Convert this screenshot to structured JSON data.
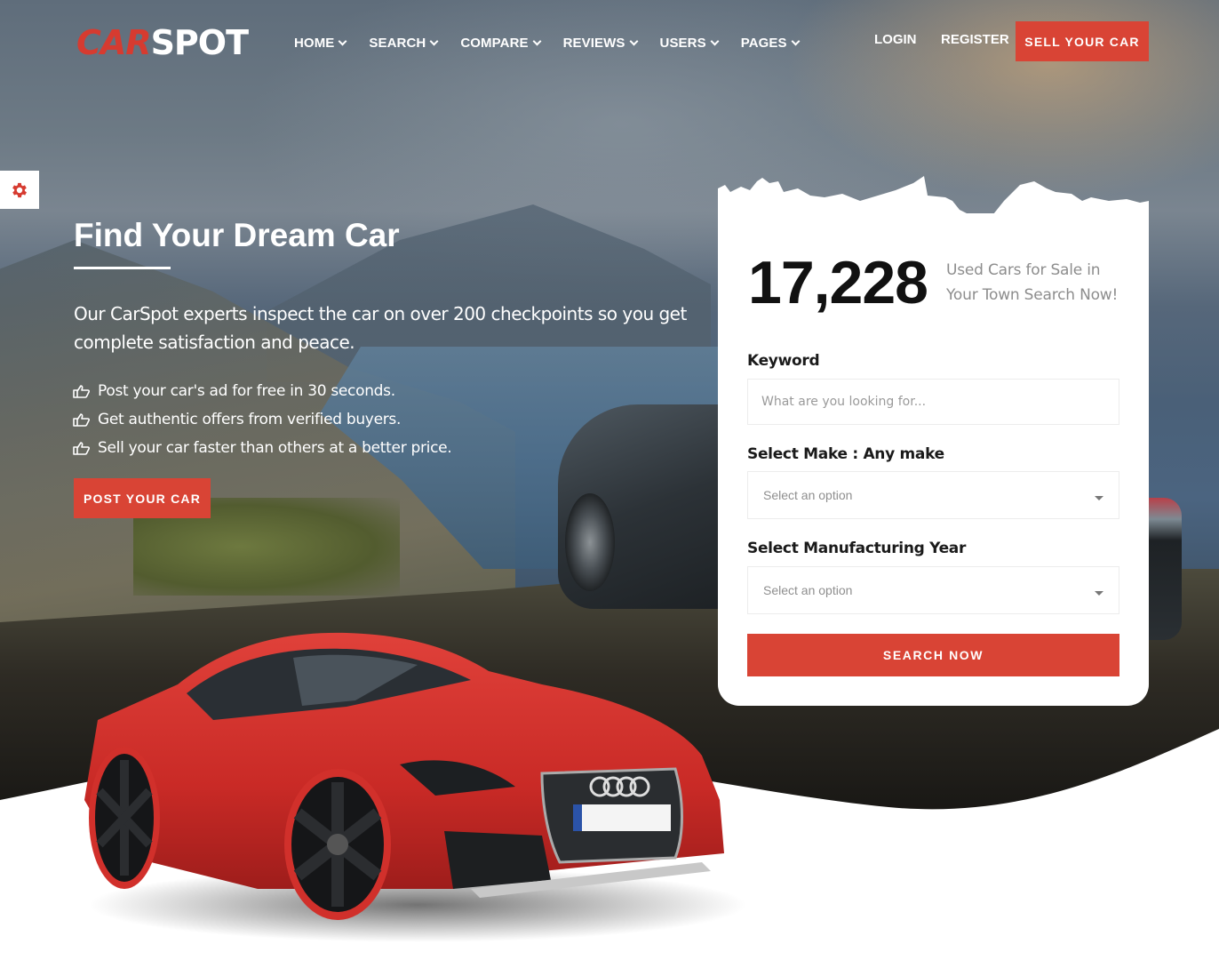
{
  "brand": {
    "logo_part1": "CAR",
    "logo_part2": "SPOT",
    "accent_color": "#d94435"
  },
  "nav": {
    "items": [
      {
        "label": "HOME",
        "icon": "chevron-down-icon"
      },
      {
        "label": "SEARCH",
        "icon": "chevron-down-icon"
      },
      {
        "label": "COMPARE",
        "icon": "chevron-down-icon"
      },
      {
        "label": "REVIEWS",
        "icon": "chevron-down-icon"
      },
      {
        "label": "USERS",
        "icon": "chevron-down-icon"
      },
      {
        "label": "PAGES",
        "icon": "chevron-down-icon"
      }
    ],
    "login": "LOGIN",
    "register": "REGISTER",
    "sell_button": "SELL YOUR CAR"
  },
  "settings": {
    "icon": "gear-icon"
  },
  "hero": {
    "title": "Find Your Dream Car",
    "description": "Our CarSpot experts inspect the car on over 200 checkpoints so you get complete satisfaction and peace.",
    "bullets": [
      {
        "icon": "thumbs-up-icon",
        "text": "Post your car's ad for free in 30 seconds."
      },
      {
        "icon": "thumbs-up-icon",
        "text": "Get authentic offers from verified buyers."
      },
      {
        "icon": "thumbs-up-icon",
        "text": "Sell your car faster than others at a better price."
      }
    ],
    "post_button": "POST YOUR CAR"
  },
  "search_card": {
    "count": "17,228",
    "count_caption": "Used Cars for Sale in Your Town Search Now!",
    "keyword_label": "Keyword",
    "keyword_placeholder": "What are you looking for...",
    "keyword_value": "",
    "make_label": "Select Make : Any make",
    "make_selected": "Select an option",
    "year_label": "Select Manufacturing Year",
    "year_selected": "Select an option",
    "search_button": "SEARCH NOW"
  }
}
